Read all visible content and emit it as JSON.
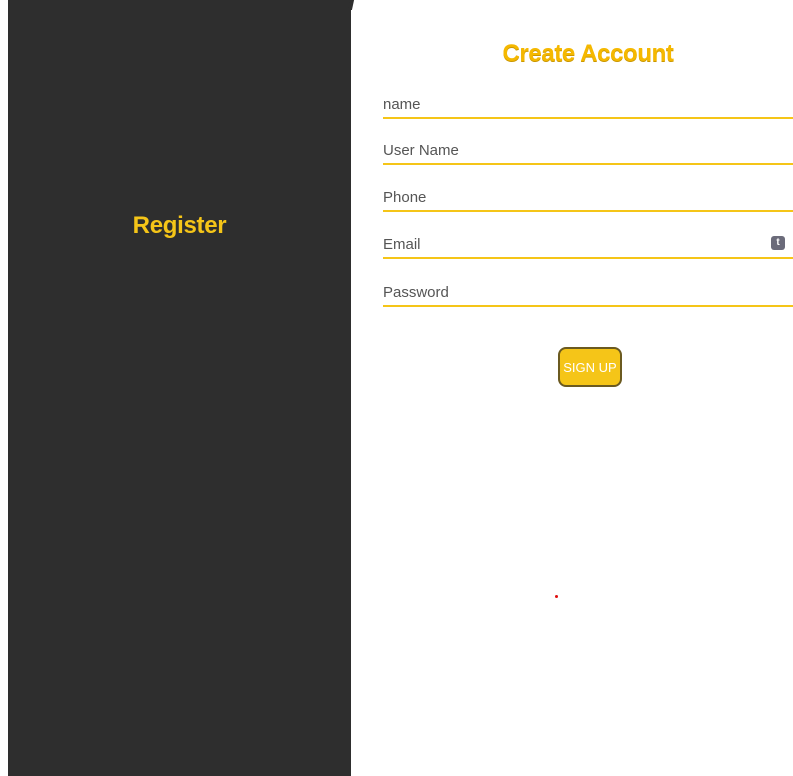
{
  "side_panel": {
    "title": "Register"
  },
  "form": {
    "title": "Create Account",
    "fields": {
      "name": {
        "placeholder": "name",
        "value": ""
      },
      "username": {
        "placeholder": "User Name",
        "value": ""
      },
      "phone": {
        "placeholder": "Phone",
        "value": ""
      },
      "email": {
        "placeholder": "Email",
        "value": "",
        "badge": "t"
      },
      "password": {
        "placeholder": "Password",
        "value": ""
      }
    },
    "submit_label": "SIGN UP"
  },
  "colors": {
    "accent": "#f5c518",
    "panel_background": "#2e2e2e",
    "page_background": "#ffffff"
  }
}
